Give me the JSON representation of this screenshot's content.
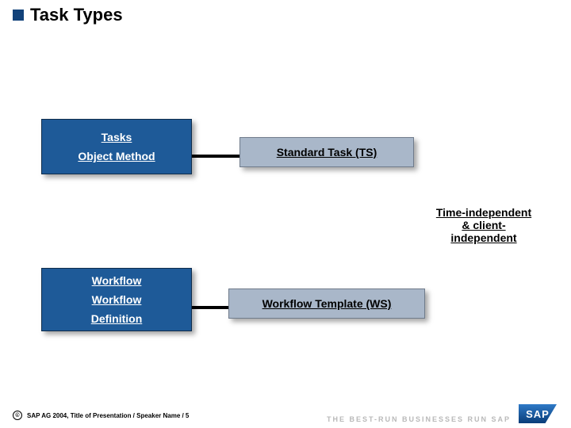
{
  "title": "Task Types",
  "left_box_1": {
    "line1": "Tasks",
    "line2": "Object Method"
  },
  "right_box_1": "Standard Task (TS)",
  "left_box_2": {
    "line1": "Workflow",
    "line2": "Workflow",
    "line3": "Definition"
  },
  "right_box_2": "Workflow Template (WS)",
  "note_line1": "Time-independent",
  "note_line2": "& client-",
  "note_line3": "independent",
  "footer": "SAP AG 2004, Title of Presentation / Speaker Name / 5",
  "copy": "©",
  "sap_tag": "THE BEST-RUN BUSINESSES RUN SAP",
  "sap_mark": "SAP"
}
